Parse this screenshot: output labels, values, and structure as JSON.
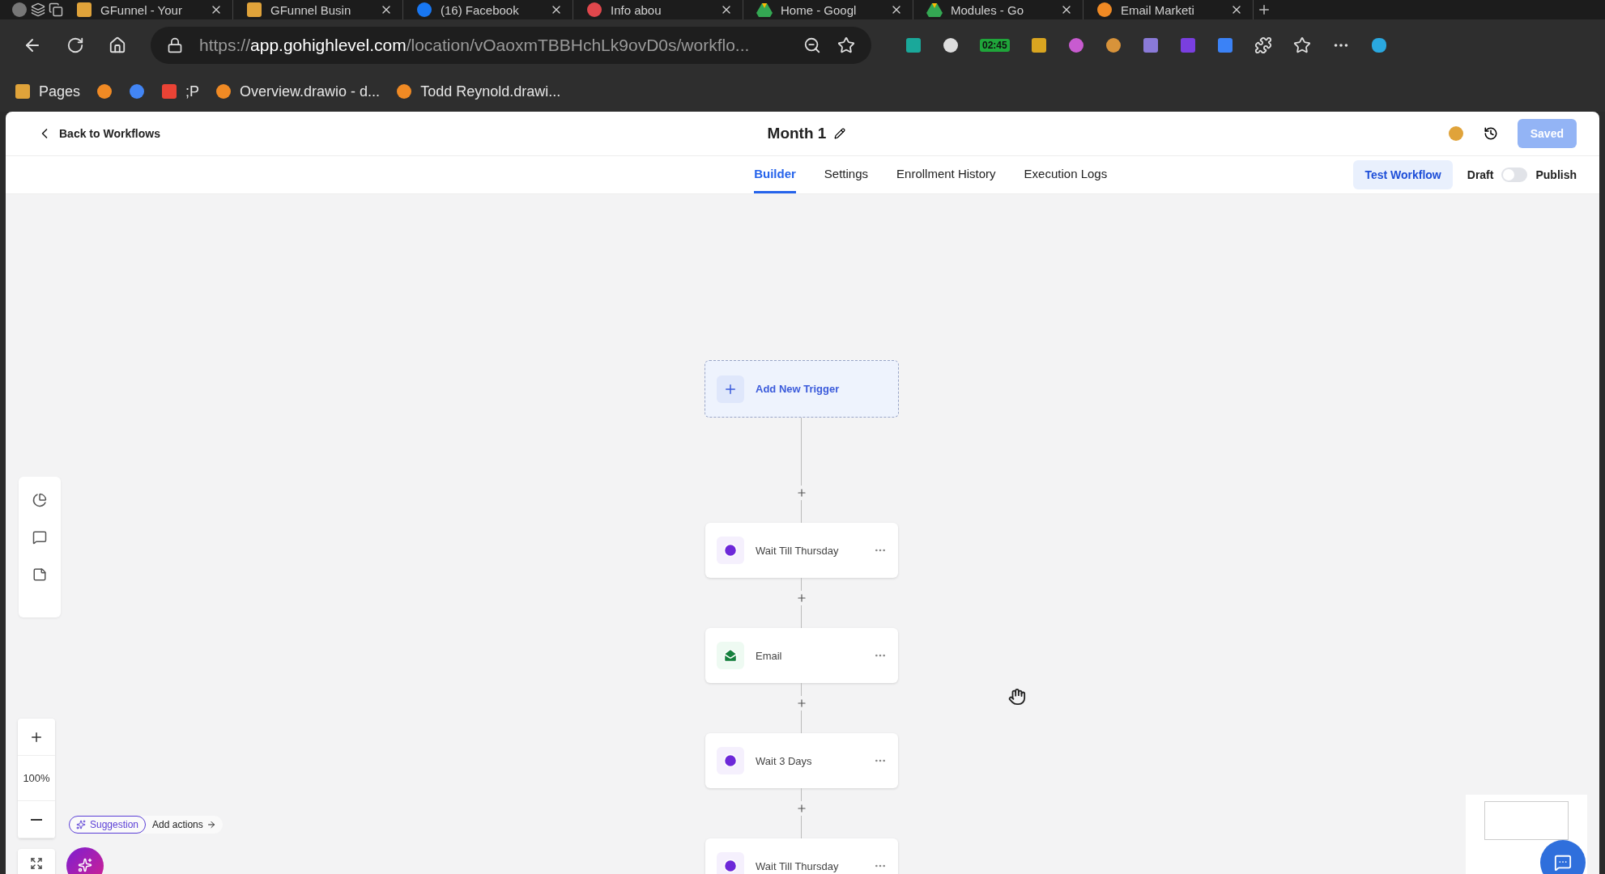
{
  "browser": {
    "tabs": [
      {
        "title": "GFunnel - Your",
        "selected": false
      },
      {
        "title": "GFunnel Busin",
        "selected": false
      },
      {
        "title": "(16) Facebook",
        "selected": false
      },
      {
        "title": "Info abou",
        "selected": false
      },
      {
        "title": "Home - Googl",
        "selected": false
      },
      {
        "title": "Modules - Go",
        "selected": false
      },
      {
        "title": "Email Marketi",
        "selected": false
      }
    ],
    "address": {
      "scheme": "https://",
      "host": "app.gohighlevel.com",
      "path": "/location/vOaoxmTBBHchLk9ovD0s/workflo..."
    },
    "extension_badge": "02:45",
    "bookmarks": [
      "Pages",
      ";P",
      "Overview.drawio - d...",
      "Todd Reynold.drawi..."
    ]
  },
  "header": {
    "back": "Back to Workflows",
    "title": "Month 1",
    "saved": "Saved"
  },
  "tabs": [
    {
      "label": "Builder",
      "selected": true
    },
    {
      "label": "Settings",
      "selected": false
    },
    {
      "label": "Enrollment History",
      "selected": false
    },
    {
      "label": "Execution Logs",
      "selected": false
    }
  ],
  "test_button": "Test Workflow",
  "publish": {
    "off_label": "Draft",
    "on_label": "Publish",
    "on": false
  },
  "trigger": {
    "label": "Add New Trigger"
  },
  "steps": [
    {
      "kind": "wait",
      "label": "Wait Till Thursday"
    },
    {
      "kind": "email",
      "label": "Email"
    },
    {
      "kind": "wait",
      "label": "Wait 3 Days"
    },
    {
      "kind": "wait",
      "label": "Wait Till Thursday"
    }
  ],
  "zoom": "100%",
  "suggestion": {
    "badge": "Suggestion",
    "action": "Add actions"
  }
}
